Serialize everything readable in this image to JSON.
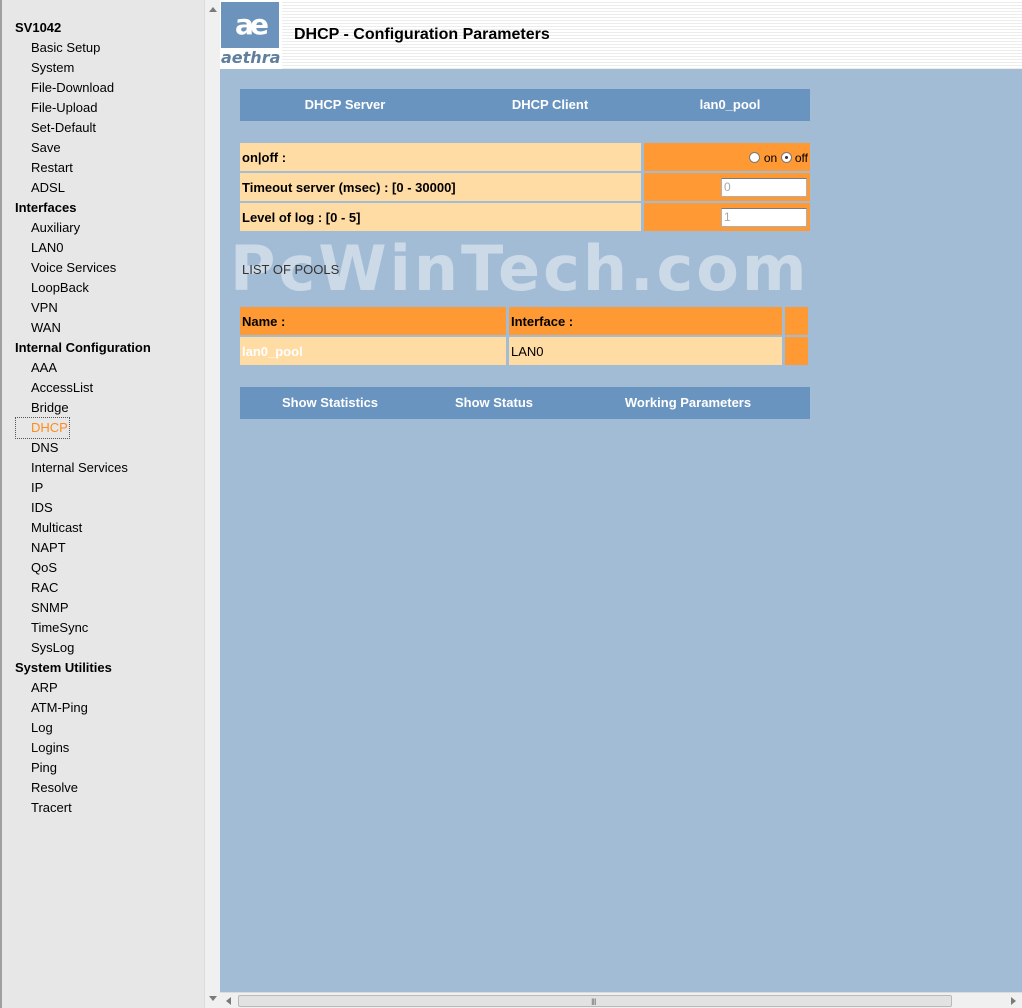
{
  "nav": {
    "device": "SV1042",
    "setup_items": [
      "Basic Setup",
      "System",
      "File-Download",
      "File-Upload",
      "Set-Default",
      "Save",
      "Restart",
      "ADSL"
    ],
    "interfaces_title": "Interfaces",
    "interfaces_items": [
      "Auxiliary",
      "LAN0",
      "Voice Services",
      "LoopBack",
      "VPN",
      "WAN"
    ],
    "internal_title": "Internal Configuration",
    "internal_items": [
      "AAA",
      "AccessList",
      "Bridge",
      "DHCP",
      "DNS",
      "Internal Services",
      "IP",
      "IDS",
      "Multicast",
      "NAPT",
      "QoS",
      "RAC",
      "SNMP",
      "TimeSync",
      "SysLog"
    ],
    "utilities_title": "System Utilities",
    "utilities_items": [
      "ARP",
      "ATM-Ping",
      "Log",
      "Logins",
      "Ping",
      "Resolve",
      "Tracert"
    ],
    "active_item": "DHCP"
  },
  "header": {
    "logo_mark": "ae",
    "logo_word": "aethra",
    "title": "DHCP - Configuration Parameters"
  },
  "tabs": [
    "DHCP Server",
    "DHCP Client",
    "lan0_pool"
  ],
  "params": {
    "onoff_label": "on|off :",
    "on_label": "on",
    "off_label": "off",
    "onoff_selected": "off",
    "timeout_label": "Timeout server (msec) : [0 - 30000]",
    "timeout_value": "0",
    "log_label": "Level of log : [0 - 5]",
    "log_value": "1"
  },
  "watermark": "PcWinTech.com",
  "pools": {
    "title": "LIST OF POOLS",
    "headers": [
      "Name :",
      "Interface :"
    ],
    "rows": [
      {
        "name": "lan0_pool",
        "interface": "LAN0"
      }
    ]
  },
  "actions": [
    "Show Statistics",
    "Show Status",
    "Working Parameters"
  ],
  "scrollbar": {
    "grip": "III"
  }
}
